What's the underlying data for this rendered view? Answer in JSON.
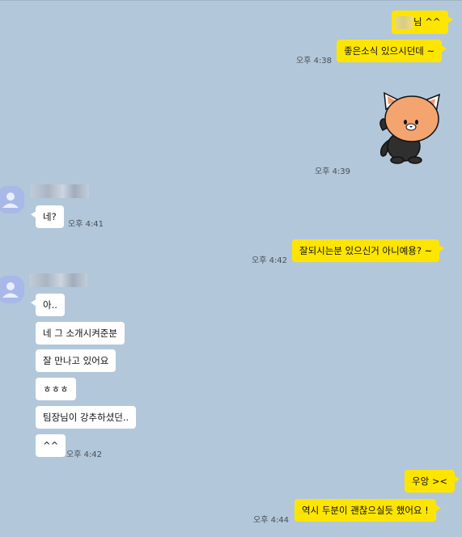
{
  "messages": {
    "m1": {
      "text": "님 ^^"
    },
    "m2": {
      "text": "좋은소식 있으시던데 ~",
      "time": "오후 4:38"
    },
    "sticker": {
      "time": "오후 4:39"
    },
    "m3": {
      "text": "네?",
      "time": "오후 4:41"
    },
    "m4": {
      "text": "잘되시는분 있으신거 아니예용? ~",
      "time": "오후 4:42"
    },
    "m5": {
      "text": "아.."
    },
    "m6": {
      "text": "네 그 소개시켜준분"
    },
    "m7": {
      "text": "잘 만나고 있어요"
    },
    "m8": {
      "text": "ㅎㅎㅎ"
    },
    "m9": {
      "text": "팀장님이 강추하셨던.."
    },
    "m10": {
      "text": "^^",
      "time": "오후 4:42"
    },
    "m11": {
      "text": "우앙 ><"
    },
    "m12": {
      "text": "역시 두분이 괜찮으실듯 했어요 !",
      "time": "오후 4:44"
    }
  },
  "colors": {
    "background": "#b2c7da",
    "my_bubble": "#fee500",
    "other_bubble": "#ffffff"
  },
  "icons": {
    "avatar": "default-profile-icon",
    "sticker": "cat-character-sticker"
  }
}
